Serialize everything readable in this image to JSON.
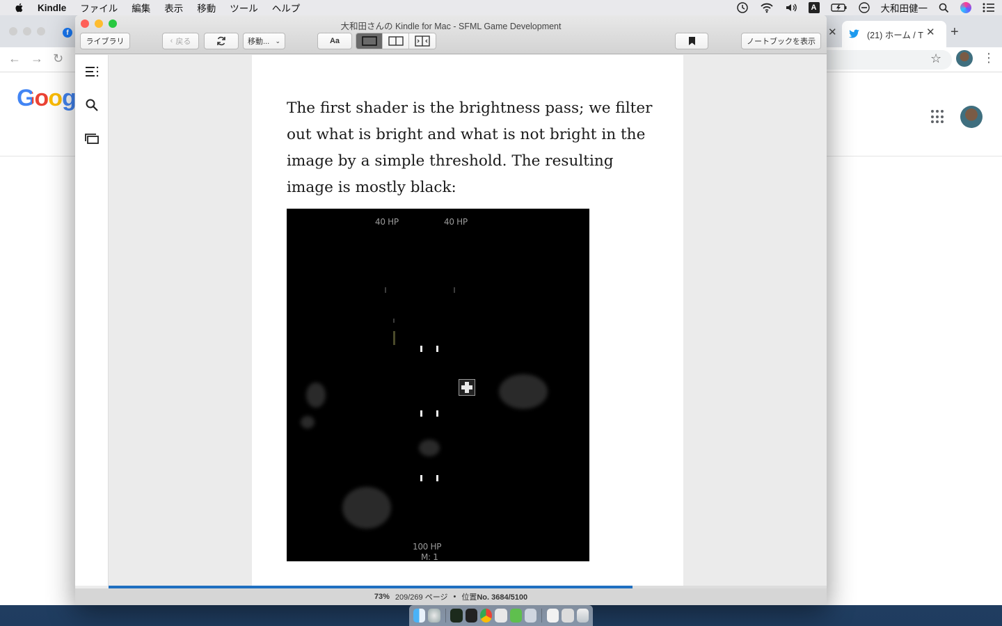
{
  "menubar": {
    "app_name": "Kindle",
    "items": [
      "ファイル",
      "編集",
      "表示",
      "移動",
      "ツール",
      "ヘルプ"
    ],
    "user_name": "大和田健一",
    "input_mode": "A"
  },
  "chrome": {
    "tab_title": "(21) ホーム / T",
    "google_logo": "Google"
  },
  "kindle": {
    "window_title": "大和田さんの Kindle for Mac - SFML Game Development",
    "toolbar": {
      "library_label": "ライブラリ",
      "back_label": "戻る",
      "goto_label": "移動...",
      "font_label": "Aa",
      "notebook_label": "ノートブックを表示"
    },
    "page": {
      "paragraph": "The first shader is the brightness pass; we filter out what is bright and what is not bright in the image by a simple threshold. The resulting image is mostly black:",
      "figure": {
        "hp_left": "40 HP",
        "hp_right": "40 HP",
        "player_hp": "100 HP",
        "missiles": "M: 1"
      }
    },
    "status": {
      "percent": "73%",
      "pages": "209/269 ページ",
      "dot": "•",
      "location_prefix": "位置",
      "location": "No. 3684/5100"
    },
    "progress_fraction": 0.73
  },
  "colors": {
    "accent": "#1f6fc0",
    "close": "#fe5f57",
    "minimize": "#febc2e",
    "zoom": "#28c840"
  }
}
